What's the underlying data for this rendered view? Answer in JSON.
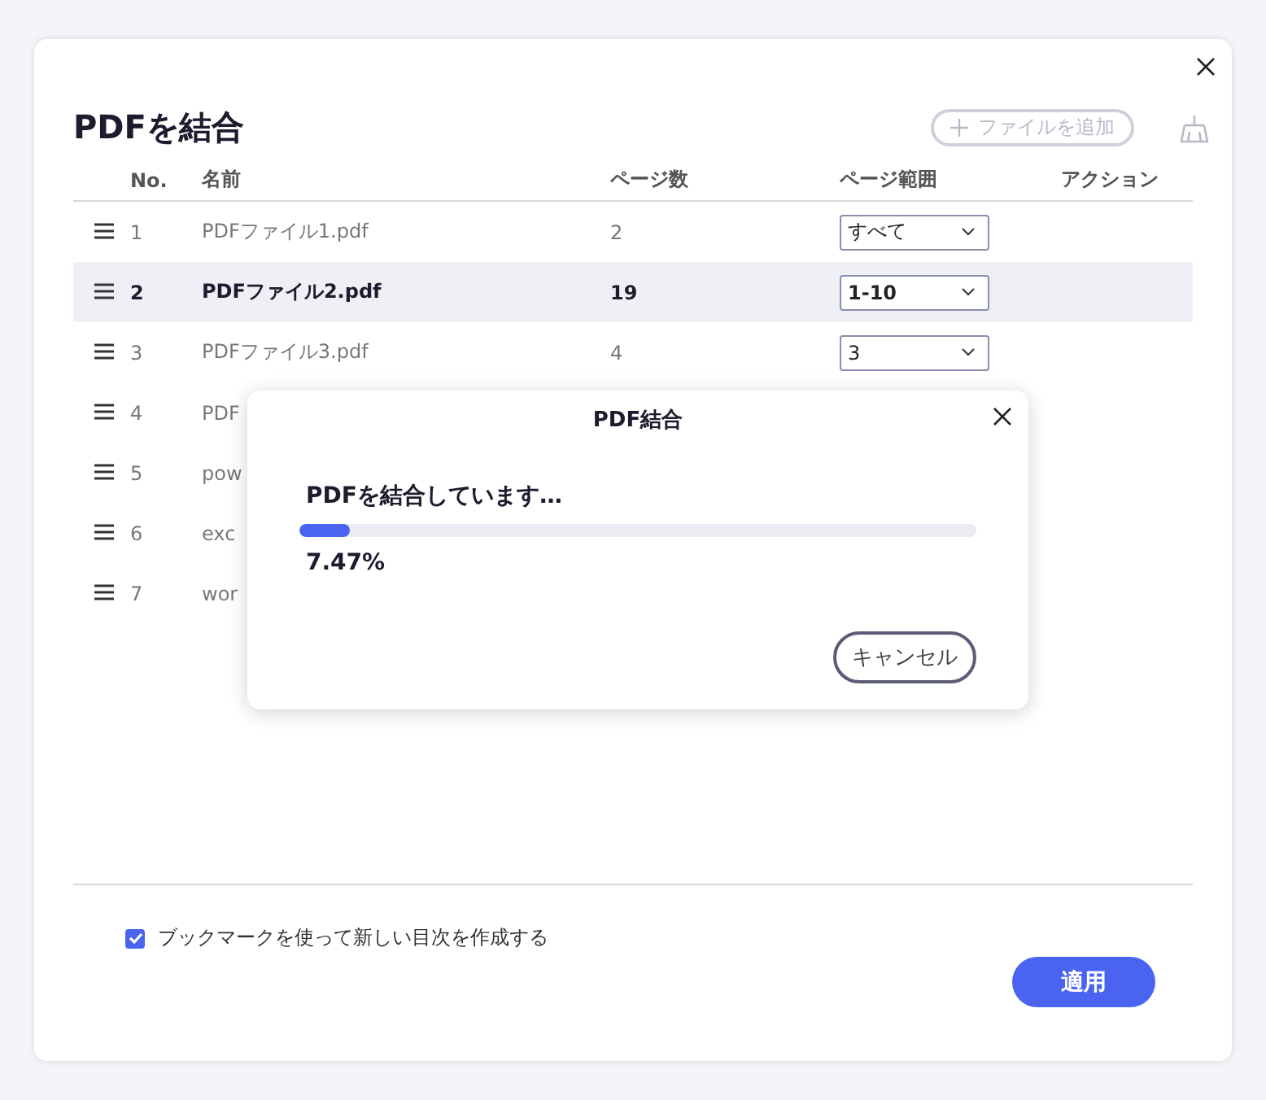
{
  "window": {
    "title": "PDFを結合"
  },
  "toolbar": {
    "add_file": {
      "label": "ファイルを追加",
      "disabled": true
    }
  },
  "table": {
    "columns": [
      "No.",
      "名前",
      "ページ数",
      "ページ範囲",
      "アクション"
    ],
    "rows": [
      {
        "no": "1",
        "name": "PDFファイル1.pdf",
        "pages": "2",
        "range": "すべて",
        "selected": false
      },
      {
        "no": "2",
        "name": "PDFファイル2.pdf",
        "pages": "19",
        "range": "1-10",
        "selected": true
      },
      {
        "no": "3",
        "name": "PDFファイル3.pdf",
        "pages": "4",
        "range": "3",
        "selected": false
      },
      {
        "no": "4",
        "name": "PDF",
        "selected": false
      },
      {
        "no": "5",
        "name": "pow",
        "selected": false
      },
      {
        "no": "6",
        "name": "exc",
        "selected": false
      },
      {
        "no": "7",
        "name": "wor",
        "selected": false
      }
    ]
  },
  "bookmark_option": {
    "label": "ブックマークを使って新しい目次を作成する",
    "checked": true
  },
  "apply_button": "適用",
  "progress_dialog": {
    "title": "PDF結合",
    "message": "PDFを結合しています…",
    "level": 0.0747,
    "reading": "7.47%",
    "cancel": "キャンセル"
  }
}
